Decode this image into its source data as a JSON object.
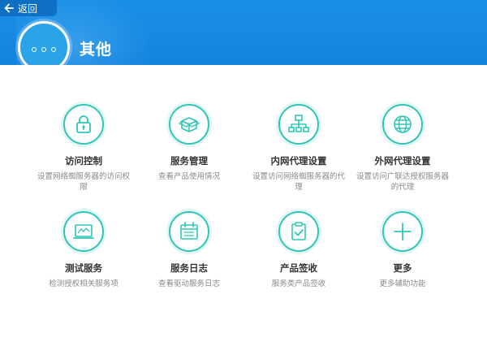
{
  "header": {
    "back_label": "返回",
    "title": "其他",
    "bg_color": "#1a8fe6"
  },
  "accent_color": "#2fc6b5",
  "tiles": [
    {
      "icon": "lock-icon",
      "title": "访问控制",
      "desc": "设置网络蜘服务器的访问权限"
    },
    {
      "icon": "box-icon",
      "title": "服务管理",
      "desc": "查看产品使用情况"
    },
    {
      "icon": "network-icon",
      "title": "内网代理设置",
      "desc": "设置访问网络蜘服务器的代理"
    },
    {
      "icon": "globe-icon",
      "title": "外网代理设置",
      "desc": "设置访问广联达授权服务器的代理"
    },
    {
      "icon": "monitor-icon",
      "title": "测试服务",
      "desc": "检测授权相关服务项"
    },
    {
      "icon": "calendar-icon",
      "title": "服务日志",
      "desc": "查看驱动服务日志"
    },
    {
      "icon": "clipboard-check-icon",
      "title": "产品签收",
      "desc": "服务类产品签收"
    },
    {
      "icon": "plus-icon",
      "title": "更多",
      "desc": "更多辅助功能"
    }
  ]
}
